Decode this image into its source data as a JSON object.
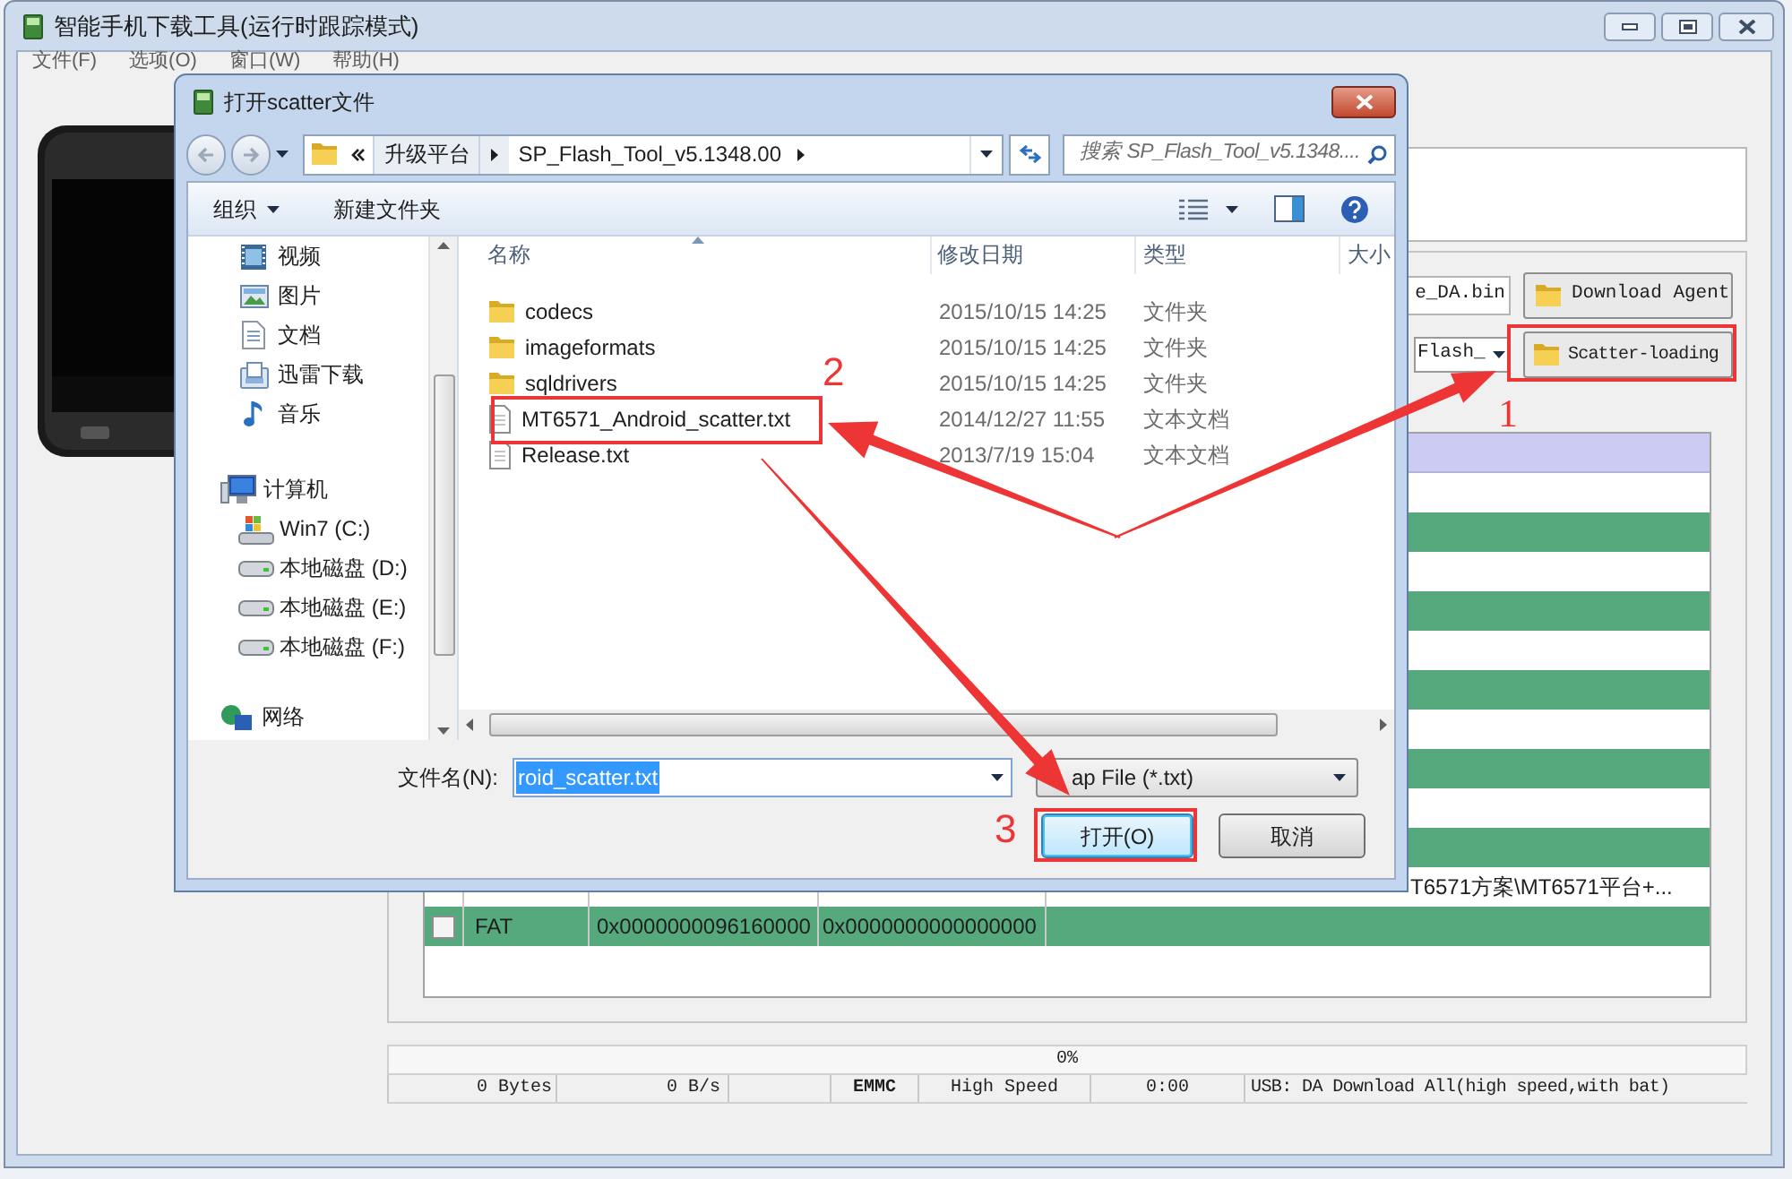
{
  "window": {
    "title": "智能手机下载工具(运行时跟踪模式)"
  },
  "menu": [
    "文件(F)",
    "选项(O)",
    "窗口(W)",
    "帮助(H)"
  ],
  "download_agent": {
    "value": "e_DA.bin",
    "button": "Download Agent"
  },
  "scatter": {
    "value": "Flash_",
    "button": "Scatter-loading"
  },
  "table": {
    "rows": [
      {
        "location": "T6571方案\\MT6571平台+..."
      },
      {
        "checked": false,
        "name": "FAT",
        "begin_address": "0x0000000096160000",
        "end_address": "0x0000000000000000"
      }
    ]
  },
  "progress": {
    "text": "0%",
    "level": 0
  },
  "status_bar": {
    "bytes": "0 Bytes",
    "speed": "0 B/s",
    "storage": "EMMC",
    "mode": "High Speed",
    "time": "0:00",
    "usb": "USB: DA Download All(high speed,with bat)"
  },
  "dialog": {
    "title": "打开scatter文件",
    "path": [
      "升级平台",
      "SP_Flash_Tool_v5.1348.00"
    ],
    "search": {
      "placeholder": "搜索 SP_Flash_Tool_v5.1348...."
    },
    "toolbar": [
      "组织",
      "新建文件夹"
    ],
    "nav": {
      "libraries": [
        {
          "label": "视频",
          "kind": "video"
        },
        {
          "label": "图片",
          "kind": "picture"
        },
        {
          "label": "文档",
          "kind": "document"
        },
        {
          "label": "迅雷下载",
          "kind": "download"
        },
        {
          "label": "音乐",
          "kind": "music"
        }
      ],
      "computer": {
        "label": "计算机",
        "children": [
          {
            "label": "Win7 (C:)",
            "kind": "system-drive"
          },
          {
            "label": "本地磁盘 (D:)",
            "kind": "drive"
          },
          {
            "label": "本地磁盘 (E:)",
            "kind": "drive"
          },
          {
            "label": "本地磁盘 (F:)",
            "kind": "drive"
          }
        ]
      },
      "network": {
        "label": "网络"
      }
    },
    "columns": [
      "名称",
      "修改日期",
      "类型",
      "大小"
    ],
    "files": [
      {
        "name": "codecs",
        "date": "2015/10/15 14:25",
        "type": "文件夹",
        "kind": "folder"
      },
      {
        "name": "imageformats",
        "date": "2015/10/15 14:25",
        "type": "文件夹",
        "kind": "folder"
      },
      {
        "name": "sqldrivers",
        "date": "2015/10/15 14:25",
        "type": "文件夹",
        "kind": "folder"
      },
      {
        "name": "MT6571_Android_scatter.txt",
        "date": "2014/12/27 11:55",
        "type": "文本文档",
        "kind": "text"
      },
      {
        "name": "Release.txt",
        "date": "2013/7/19 15:04",
        "type": "文本文档",
        "kind": "text"
      }
    ],
    "filename": {
      "label": "文件名(N):",
      "value": "roid_scatter.txt"
    },
    "filetype": "ap File (*.txt)",
    "buttons": [
      "打开(O)",
      "取消"
    ]
  },
  "annotations": [
    "1",
    "2",
    "3"
  ]
}
